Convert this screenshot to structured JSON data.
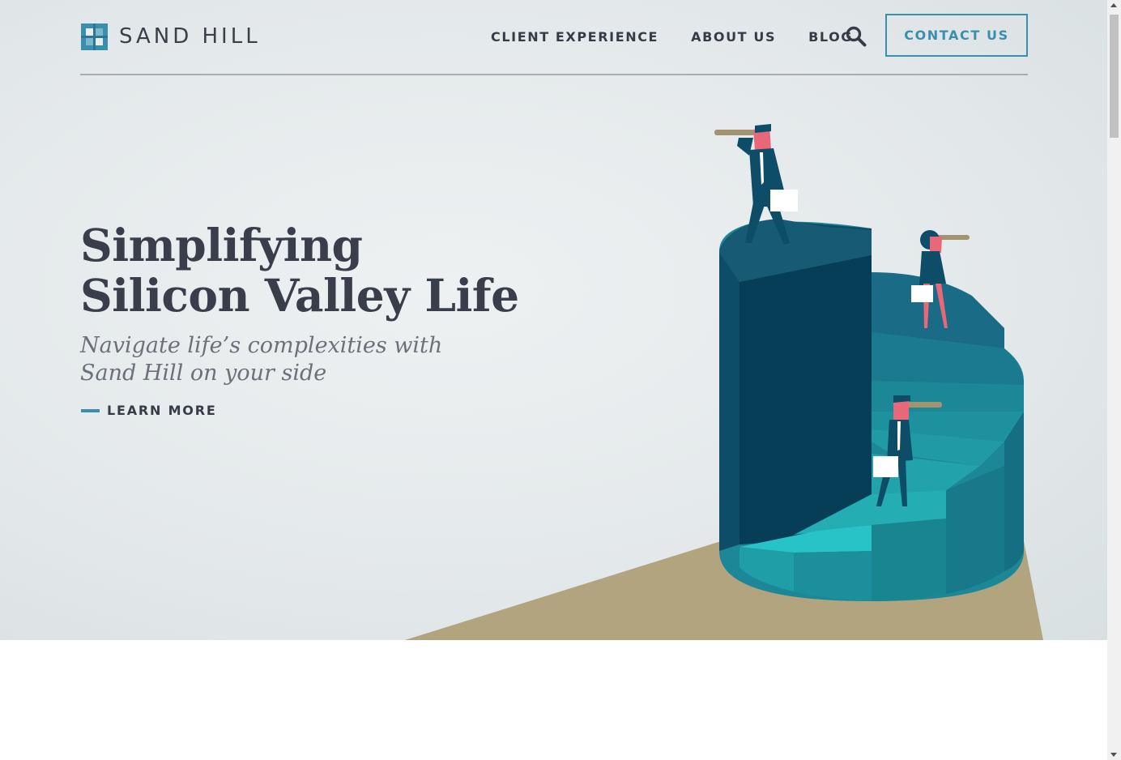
{
  "brand": {
    "name": "SAND HILL",
    "logo_color": "#3a8fae"
  },
  "nav": {
    "items": [
      {
        "label": "CLIENT EXPERIENCE"
      },
      {
        "label": "ABOUT US"
      },
      {
        "label": "BLOG"
      }
    ],
    "search_icon": "search-icon",
    "contact_label": "CONTACT US"
  },
  "hero": {
    "headline_line1": "Simplifying",
    "headline_line2": "Silicon Valley Life",
    "subheadline": "Navigate life’s complexities with Sand Hill on your side",
    "cta_label": "LEARN MORE",
    "illustration": "businesspeople-with-telescopes-on-spiral-staircase"
  },
  "colors": {
    "accent": "#3a8fae",
    "text_dark": "#3a3e4b",
    "text_muted": "#6c7079",
    "hero_bg": "#e3e8ea",
    "ground": "#b2a47e"
  }
}
